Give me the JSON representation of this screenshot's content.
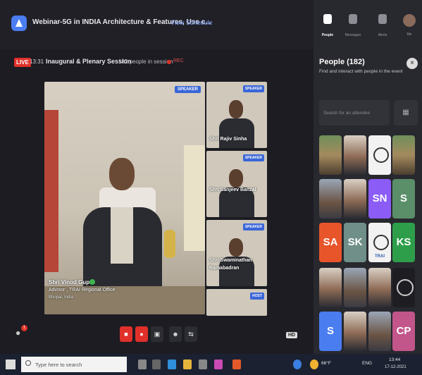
{
  "header": {
    "event_title": "Webinar-5G in INDIA Architecture & Features, Use c...",
    "view_schedule": "View Schedule"
  },
  "session": {
    "live_label": "LIVE",
    "time": "13:31",
    "title": "Inaugural & Plenary Session",
    "people_in_session": "182 people in session",
    "rec_label": "REC"
  },
  "main_speaker": {
    "tag": "SPEAKER",
    "name": "Shri Vinod Gupta",
    "role": "Advisor , TRAI Regional Office",
    "location": "Bhopal, India"
  },
  "side_tiles": [
    {
      "tag": "SPEAKER",
      "name": "Shri Rajiv Sinha"
    },
    {
      "tag": "SPEAKER",
      "name": "Shri Sanjeev Banzal"
    },
    {
      "tag": "SPEAKER",
      "name": "Shri Swaminathan Ramabadran"
    },
    {
      "tag": "HOST",
      "name": ""
    }
  ],
  "right_nav": [
    {
      "label": "People",
      "icon": "people-icon"
    },
    {
      "label": "Messages",
      "icon": "messages-icon"
    },
    {
      "label": "Alerts",
      "icon": "alerts-icon"
    },
    {
      "label": "Me",
      "icon": "avatar-icon"
    }
  ],
  "people_panel": {
    "title": "People (182)",
    "subtitle": "Find and interact with people in the event",
    "search_placeholder": "Search for an attendee",
    "avatars": [
      {
        "initials": "",
        "kind": "photo3"
      },
      {
        "initials": "",
        "kind": "photo2"
      },
      {
        "initials": "",
        "kind": "logo"
      },
      {
        "initials": "",
        "kind": "photo3"
      },
      {
        "initials": "",
        "kind": "photo"
      },
      {
        "initials": "",
        "kind": "photo2"
      },
      {
        "initials": "SN",
        "kind": "initials",
        "color": "#8b5cf6"
      },
      {
        "initials": "S",
        "kind": "initials",
        "color": "#5a8f6a"
      },
      {
        "initials": "SA",
        "kind": "initials",
        "color": "#e8552a"
      },
      {
        "initials": "SK",
        "kind": "initials",
        "color": "#6f8f88"
      },
      {
        "initials": "TRAI",
        "kind": "logo"
      },
      {
        "initials": "KS",
        "kind": "initials",
        "color": "#2e9e4a"
      },
      {
        "initials": "",
        "kind": "photo2"
      },
      {
        "initials": "",
        "kind": "photo"
      },
      {
        "initials": "",
        "kind": "photo2"
      },
      {
        "initials": "",
        "kind": "dark"
      },
      {
        "initials": "S",
        "kind": "initials",
        "color": "#4a7df0"
      },
      {
        "initials": "",
        "kind": "photo2"
      },
      {
        "initials": "",
        "kind": "photo"
      },
      {
        "initials": "CP",
        "kind": "initials",
        "color": "#c2558a"
      }
    ]
  },
  "controls": {
    "notification_count": "1",
    "hd_label": "HD"
  },
  "taskbar": {
    "search_placeholder": "Type here to search",
    "temperature": "66°F",
    "lang": "ENG",
    "time": "13:44",
    "date": "17-12-2021"
  }
}
